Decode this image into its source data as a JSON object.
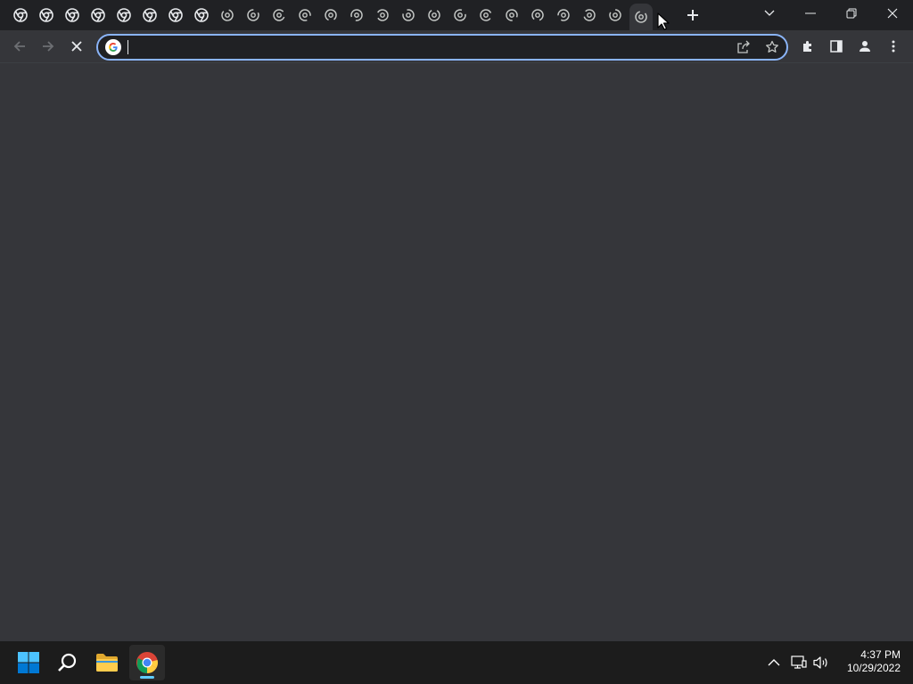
{
  "browser": {
    "tabs": [
      {
        "icon": "chrome-icon"
      },
      {
        "icon": "chrome-icon"
      },
      {
        "icon": "chrome-icon"
      },
      {
        "icon": "chrome-icon"
      },
      {
        "icon": "chrome-icon"
      },
      {
        "icon": "chrome-icon"
      },
      {
        "icon": "chrome-icon"
      },
      {
        "icon": "chrome-icon"
      },
      {
        "icon": "loading-favicon"
      },
      {
        "icon": "loading-favicon"
      },
      {
        "icon": "loading-favicon"
      },
      {
        "icon": "loading-favicon"
      },
      {
        "icon": "loading-favicon"
      },
      {
        "icon": "loading-favicon"
      },
      {
        "icon": "loading-favicon"
      },
      {
        "icon": "loading-favicon"
      },
      {
        "icon": "loading-favicon"
      },
      {
        "icon": "loading-favicon"
      },
      {
        "icon": "loading-favicon"
      },
      {
        "icon": "loading-favicon"
      },
      {
        "icon": "loading-favicon"
      },
      {
        "icon": "loading-favicon"
      },
      {
        "icon": "loading-favicon"
      },
      {
        "icon": "loading-favicon"
      },
      {
        "icon": "loading-favicon",
        "active": true
      }
    ],
    "omnibox": {
      "value": "",
      "placeholder": ""
    },
    "accent_color": "#8ab4f8"
  },
  "taskbar": {
    "apps": [
      "start",
      "search",
      "file-explorer",
      "chrome"
    ],
    "clock": {
      "time": "4:37 PM",
      "date": "10/29/2022"
    }
  }
}
